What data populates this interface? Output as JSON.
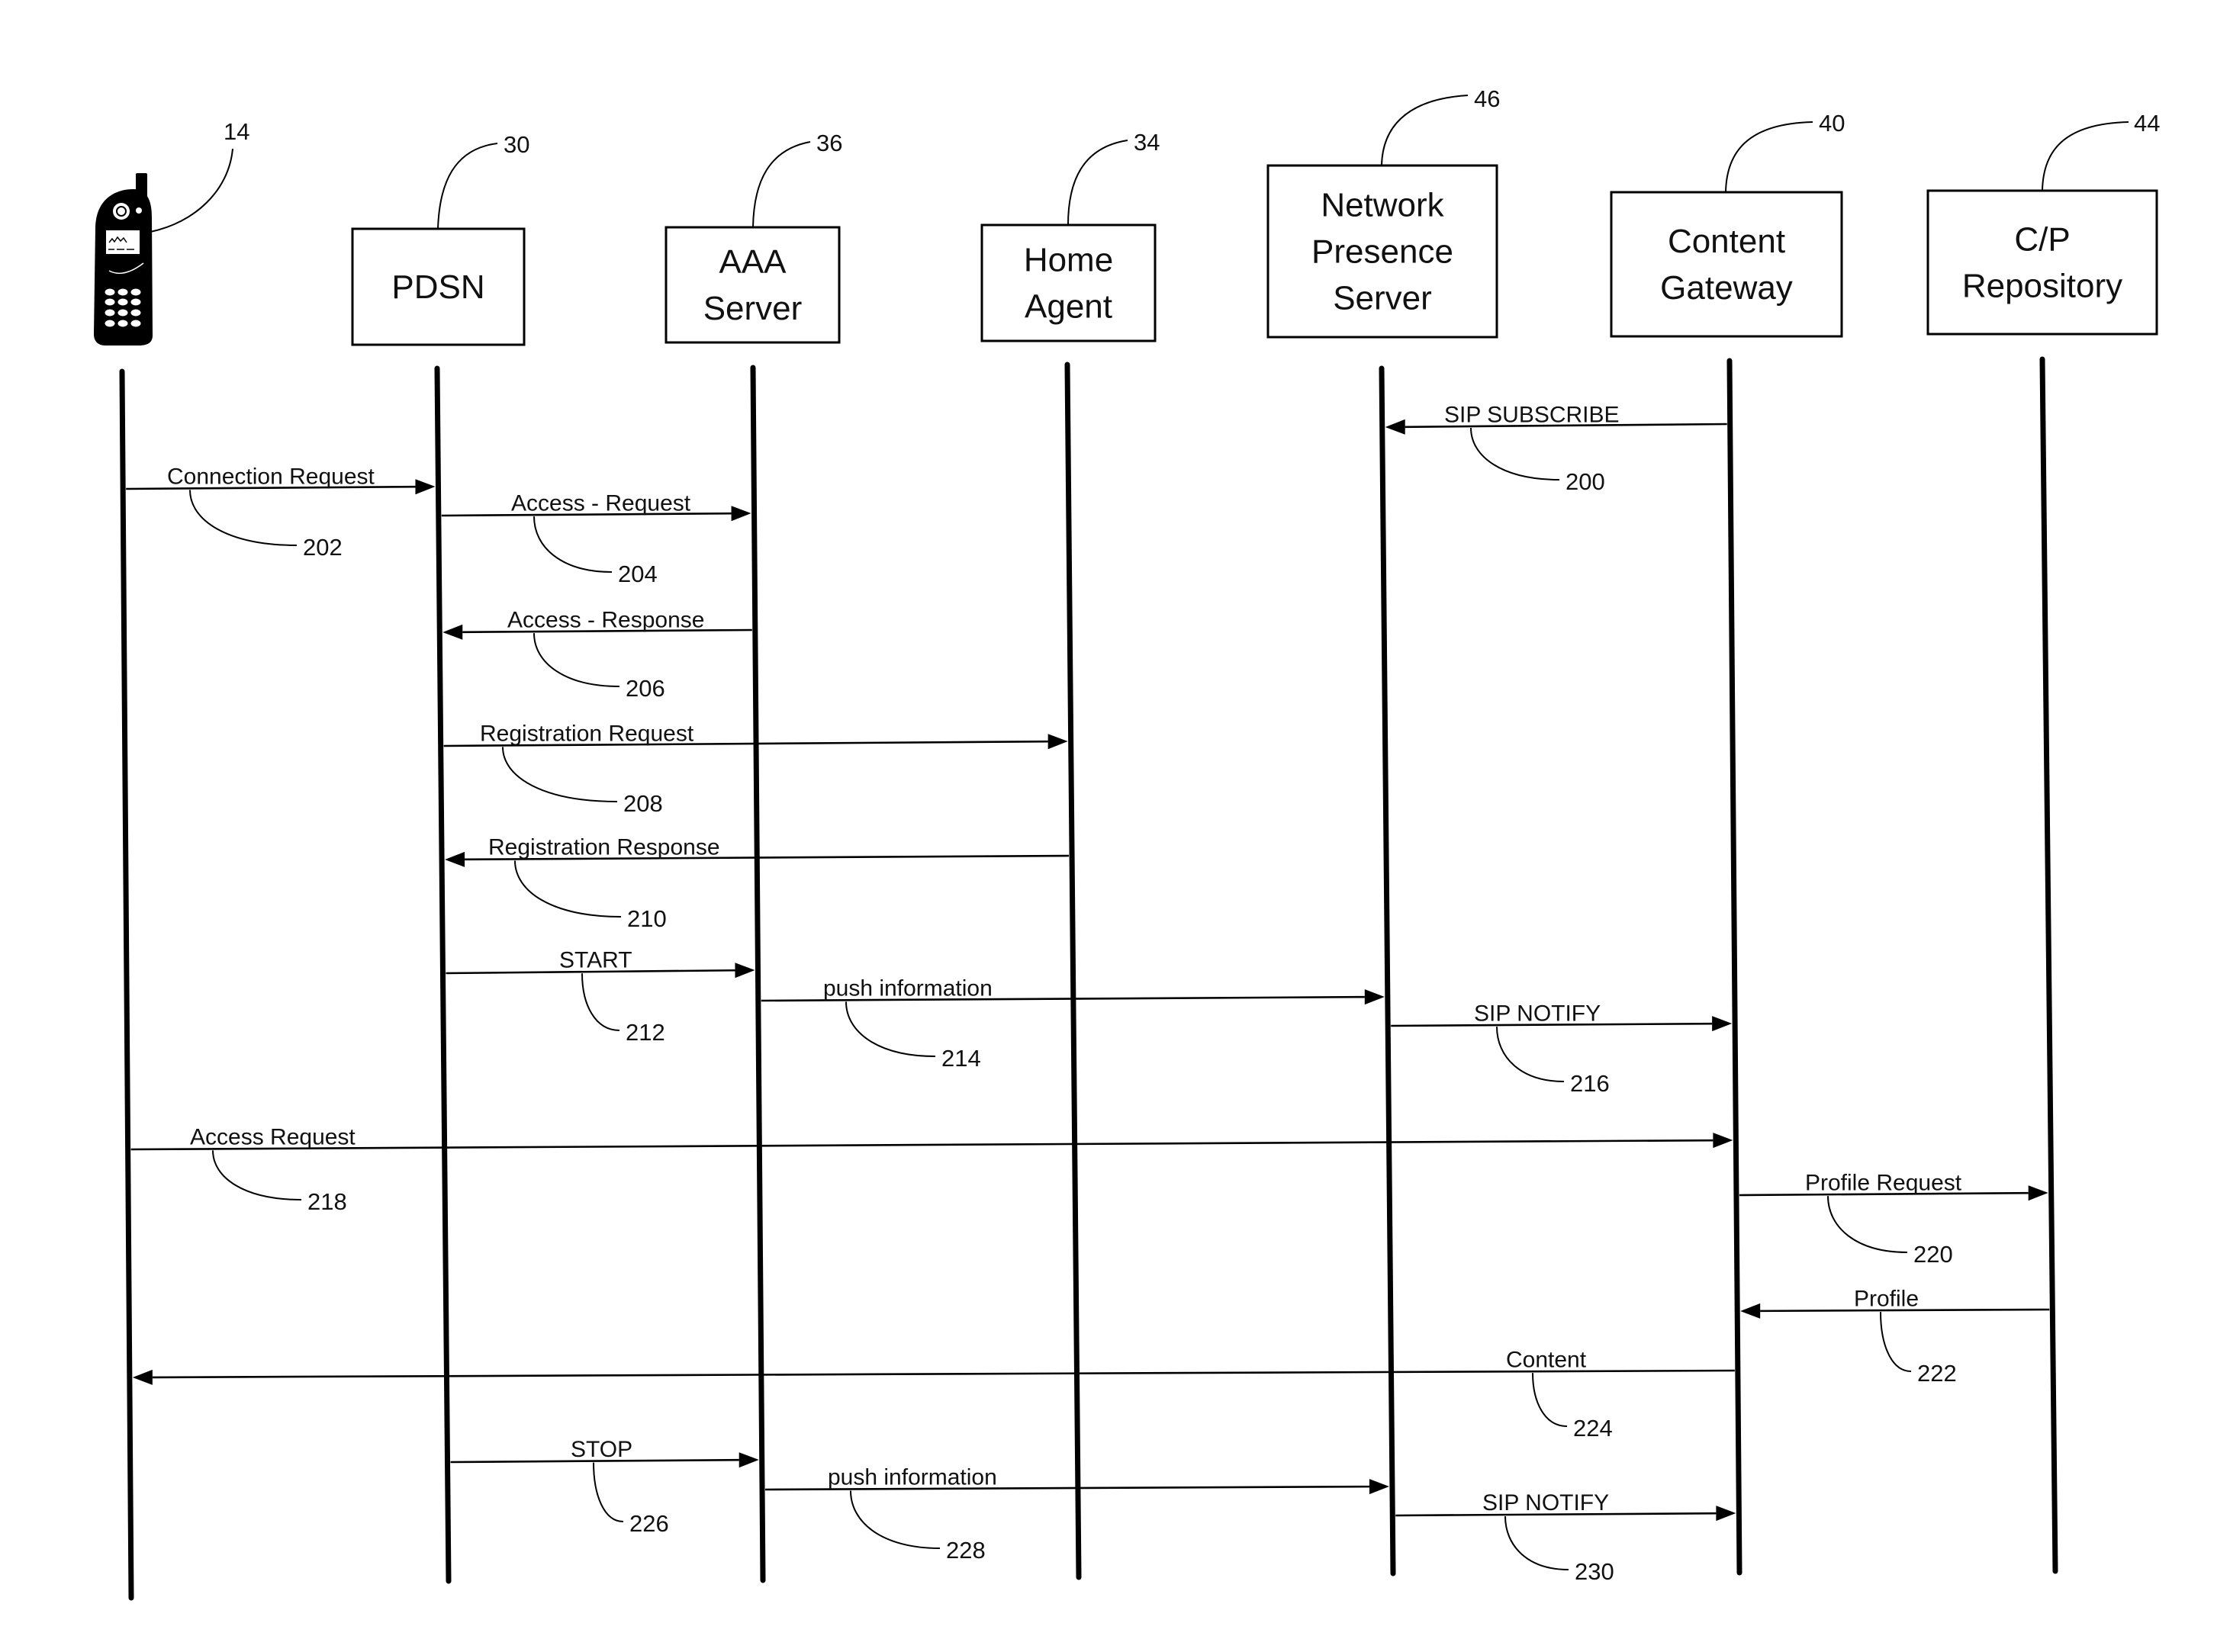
{
  "diagram": {
    "type": "sequence-diagram",
    "participants": [
      {
        "id": "mobile",
        "icon": "mobile-phone-icon",
        "lines": [],
        "ref": "14"
      },
      {
        "id": "pdsn",
        "lines": [
          "PDSN"
        ],
        "ref": "30"
      },
      {
        "id": "aaa",
        "lines": [
          "AAA",
          "Server"
        ],
        "ref": "36"
      },
      {
        "id": "home-agent",
        "lines": [
          "Home",
          "Agent"
        ],
        "ref": "34"
      },
      {
        "id": "nps",
        "lines": [
          "Network",
          "Presence",
          "Server"
        ],
        "ref": "46"
      },
      {
        "id": "content-gateway",
        "lines": [
          "Content",
          "Gateway"
        ],
        "ref": "40"
      },
      {
        "id": "cp-repository",
        "lines": [
          "C/P",
          "Repository"
        ],
        "ref": "44"
      }
    ],
    "messages": [
      {
        "label": "SIP SUBSCRIBE",
        "ref": "200",
        "from": "content-gateway",
        "to": "nps"
      },
      {
        "label": "Connection Request",
        "ref": "202",
        "from": "mobile",
        "to": "pdsn"
      },
      {
        "label": "Access - Request",
        "ref": "204",
        "from": "pdsn",
        "to": "aaa"
      },
      {
        "label": "Access - Response",
        "ref": "206",
        "from": "aaa",
        "to": "pdsn"
      },
      {
        "label": "Registration Request",
        "ref": "208",
        "from": "pdsn",
        "to": "home-agent"
      },
      {
        "label": "Registration Response",
        "ref": "210",
        "from": "home-agent",
        "to": "pdsn"
      },
      {
        "label": "START",
        "ref": "212",
        "from": "pdsn",
        "to": "aaa"
      },
      {
        "label": "push information",
        "ref": "214",
        "from": "aaa",
        "to": "nps"
      },
      {
        "label": "SIP NOTIFY",
        "ref": "216",
        "from": "nps",
        "to": "content-gateway"
      },
      {
        "label": "Access Request",
        "ref": "218",
        "from": "mobile",
        "to": "content-gateway"
      },
      {
        "label": "Profile Request",
        "ref": "220",
        "from": "content-gateway",
        "to": "cp-repository"
      },
      {
        "label": "Profile",
        "ref": "222",
        "from": "cp-repository",
        "to": "content-gateway"
      },
      {
        "label": "Content",
        "ref": "224",
        "from": "content-gateway",
        "to": "mobile"
      },
      {
        "label": "STOP",
        "ref": "226",
        "from": "pdsn",
        "to": "aaa"
      },
      {
        "label": "push information",
        "ref": "228",
        "from": "aaa",
        "to": "nps"
      },
      {
        "label": "SIP NOTIFY",
        "ref": "230",
        "from": "nps",
        "to": "content-gateway"
      }
    ]
  }
}
